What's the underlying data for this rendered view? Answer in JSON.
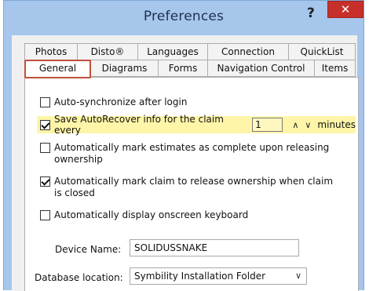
{
  "window": {
    "title": "Preferences",
    "help_glyph": "?",
    "close_glyph": "✕",
    "close_color": "#c7302a"
  },
  "tabs": {
    "back_row": [
      "Photos",
      "Disto®",
      "Languages",
      "Connection",
      "QuickList"
    ],
    "front_row": [
      "General",
      "Diagrams",
      "Forms",
      "Navigation Control",
      "Items"
    ],
    "selected": "General"
  },
  "options": {
    "auto_sync": {
      "label": "Auto-synchronize after login",
      "checked": false
    },
    "autorecover": {
      "label": "Save AutoRecover info for the claim every",
      "checked": true,
      "interval": "1",
      "unit": "minutes",
      "highlight_color": "#fff5a8"
    },
    "mark_estimates": {
      "label": "Automatically mark estimates as complete upon releasing ownership",
      "checked": false
    },
    "mark_claim": {
      "label": "Automatically mark claim to release ownership when claim is closed",
      "checked": true
    },
    "onscreen_keyboard": {
      "label": "Automatically display onscreen keyboard",
      "checked": false
    }
  },
  "device": {
    "label": "Device Name:",
    "value": "SOLIDUSSNAKE"
  },
  "database": {
    "label": "Database location:",
    "value": "Symbility Installation Folder"
  },
  "icons": {
    "spin_up": "chevron-up-icon",
    "spin_down": "chevron-down-icon",
    "dropdown": "chevron-down-icon"
  }
}
